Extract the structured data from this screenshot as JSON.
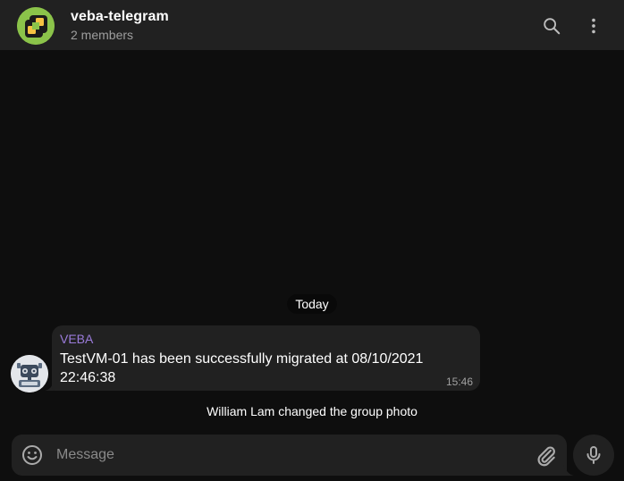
{
  "header": {
    "title": "veba-telegram",
    "members": "2 members",
    "icons": {
      "search": "search-icon",
      "more": "more-vert-icon"
    },
    "avatar_color": "#8bc34a"
  },
  "chat": {
    "date_label": "Today",
    "messages": [
      {
        "sender": "VEBA",
        "sender_color": "#9b7cdb",
        "text": "TestVM-01 has been successfully migrated at 08/10/2021 22:46:38",
        "time": "15:46"
      }
    ],
    "service_message": "William Lam changed the group photo"
  },
  "composer": {
    "placeholder": "Message",
    "value": "",
    "icons": {
      "emoji": "emoji-icon",
      "attach": "attach-icon",
      "mic": "mic-icon"
    }
  },
  "colors": {
    "background": "#0e0e0e",
    "panel": "#212121",
    "text": "#ffffff",
    "muted": "#9e9e9e"
  }
}
